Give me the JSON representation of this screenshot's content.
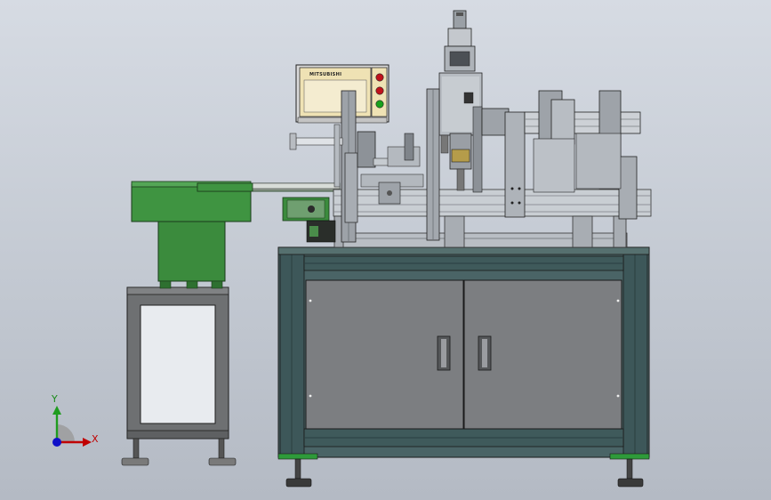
{
  "view": {
    "triad": {
      "x_label": "X",
      "y_label": "Y"
    },
    "hmi": {
      "brand_text": "MITSUBISHI"
    }
  },
  "colors": {
    "background_top": "#d6dbe3",
    "background_bottom": "#b4bac4",
    "frame_teal": "#3e5a5c",
    "panel_gray": "#7d7f82",
    "feeder_green": "#3a8a3c",
    "hmi_beige": "#efe2b4",
    "indicator_red": "#c0121b",
    "indicator_green": "#19a11c"
  }
}
